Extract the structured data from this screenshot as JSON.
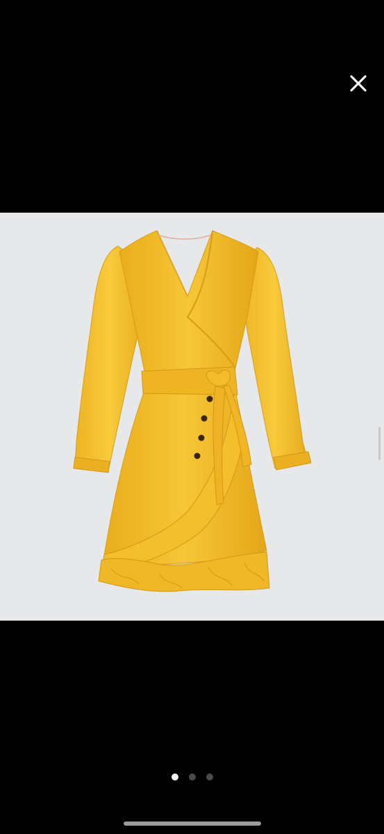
{
  "viewer": {
    "close_icon": "close-icon",
    "image_subject": "yellow-wrap-dress",
    "pager": {
      "total": 3,
      "current": 1
    },
    "colors": {
      "background": "#000000",
      "photo_background": "#e7e8ea",
      "dress": "#f2bd28",
      "buttons": "#3a2414",
      "dot_active": "#f2f2f2",
      "dot_inactive": "#4a4a4a"
    }
  }
}
